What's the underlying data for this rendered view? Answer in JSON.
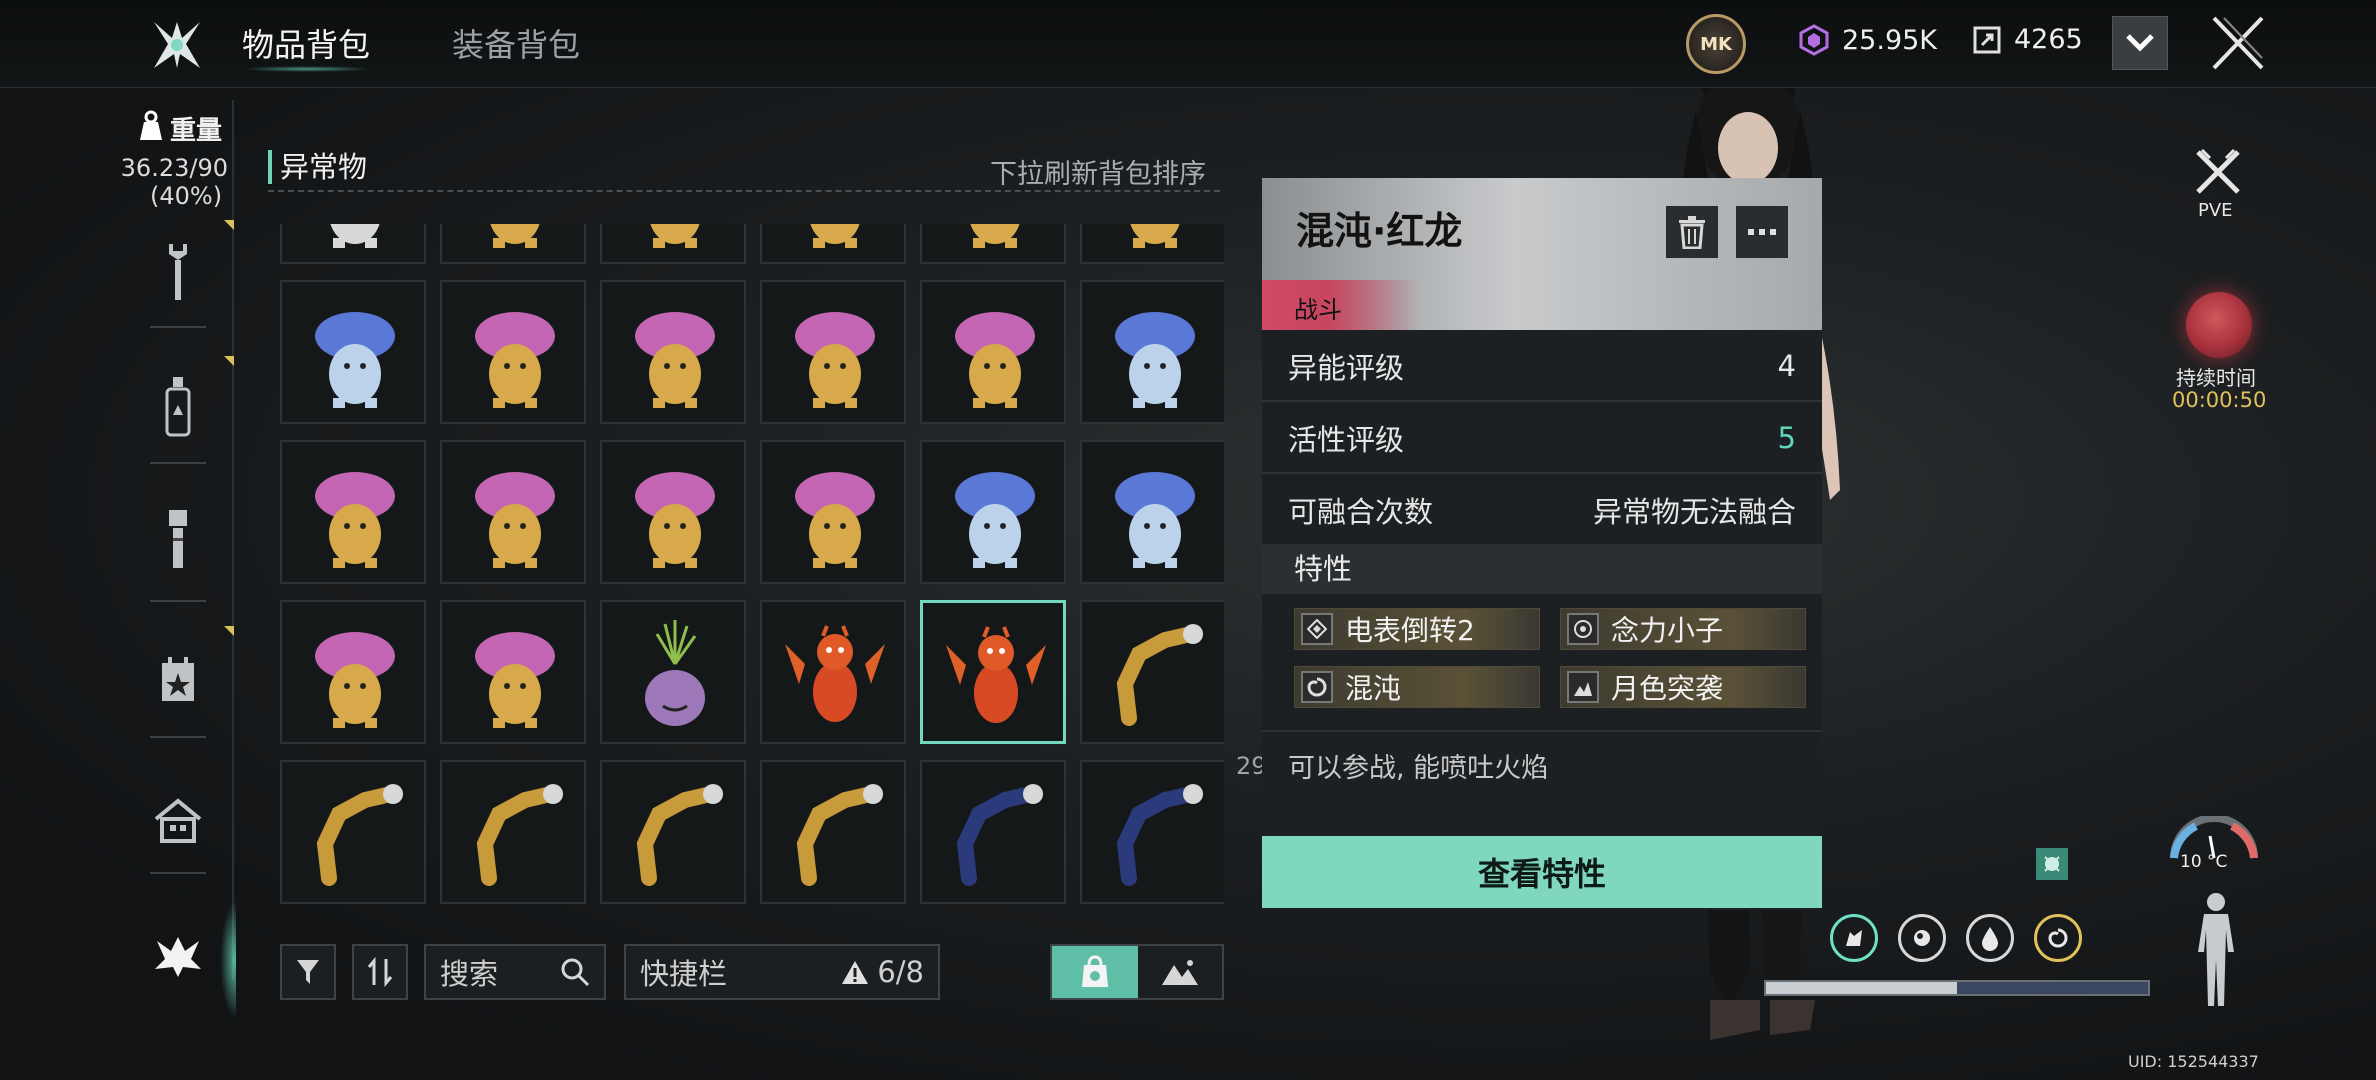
{
  "header": {
    "tabs": [
      {
        "label": "物品背包"
      },
      {
        "label": "装备背包"
      }
    ],
    "currency_badge": "MK",
    "crystals": "25.95K",
    "tokens": "4265"
  },
  "sidebar": {
    "weight_label": "重量",
    "weight_value": "36.23/90",
    "weight_percent": "(40%)",
    "categories": [
      "wrench-icon",
      "bottle-icon",
      "flashlight-icon",
      "calendar-star-icon",
      "home-icon",
      "anomaly-icon"
    ]
  },
  "inventory": {
    "section_title": "异常物",
    "hint": "下拉刷新背包排序",
    "selected_item": "混沌·红龙"
  },
  "bottombar": {
    "search_label": "搜索",
    "quickbar_label": "快捷栏",
    "quickbar_count": "6/8"
  },
  "detail": {
    "title": "混沌·红龙",
    "tag": "战斗",
    "rows": [
      {
        "label": "异能评级",
        "value": "4"
      },
      {
        "label": "活性评级",
        "value": "5"
      },
      {
        "label": "可融合次数",
        "value": "异常物无法融合"
      }
    ],
    "traits_title": "特性",
    "traits": [
      "电表倒转2",
      "念力小子",
      "混沌",
      "月色突袭"
    ],
    "description": "可以参战, 能喷吐火焰",
    "view_button": "查看特性",
    "colors": {
      "active_value": "#5fd6bb",
      "tag": "#d14a66",
      "button": "#7ed7be"
    }
  },
  "hud": {
    "pve": "PVE",
    "duration_label": "持续时间",
    "duration_value": "00:00:50",
    "temperature": "10 °C",
    "uid": "UID: 152544337",
    "stamina_fraction": 0.5,
    "peek_text": "29"
  }
}
